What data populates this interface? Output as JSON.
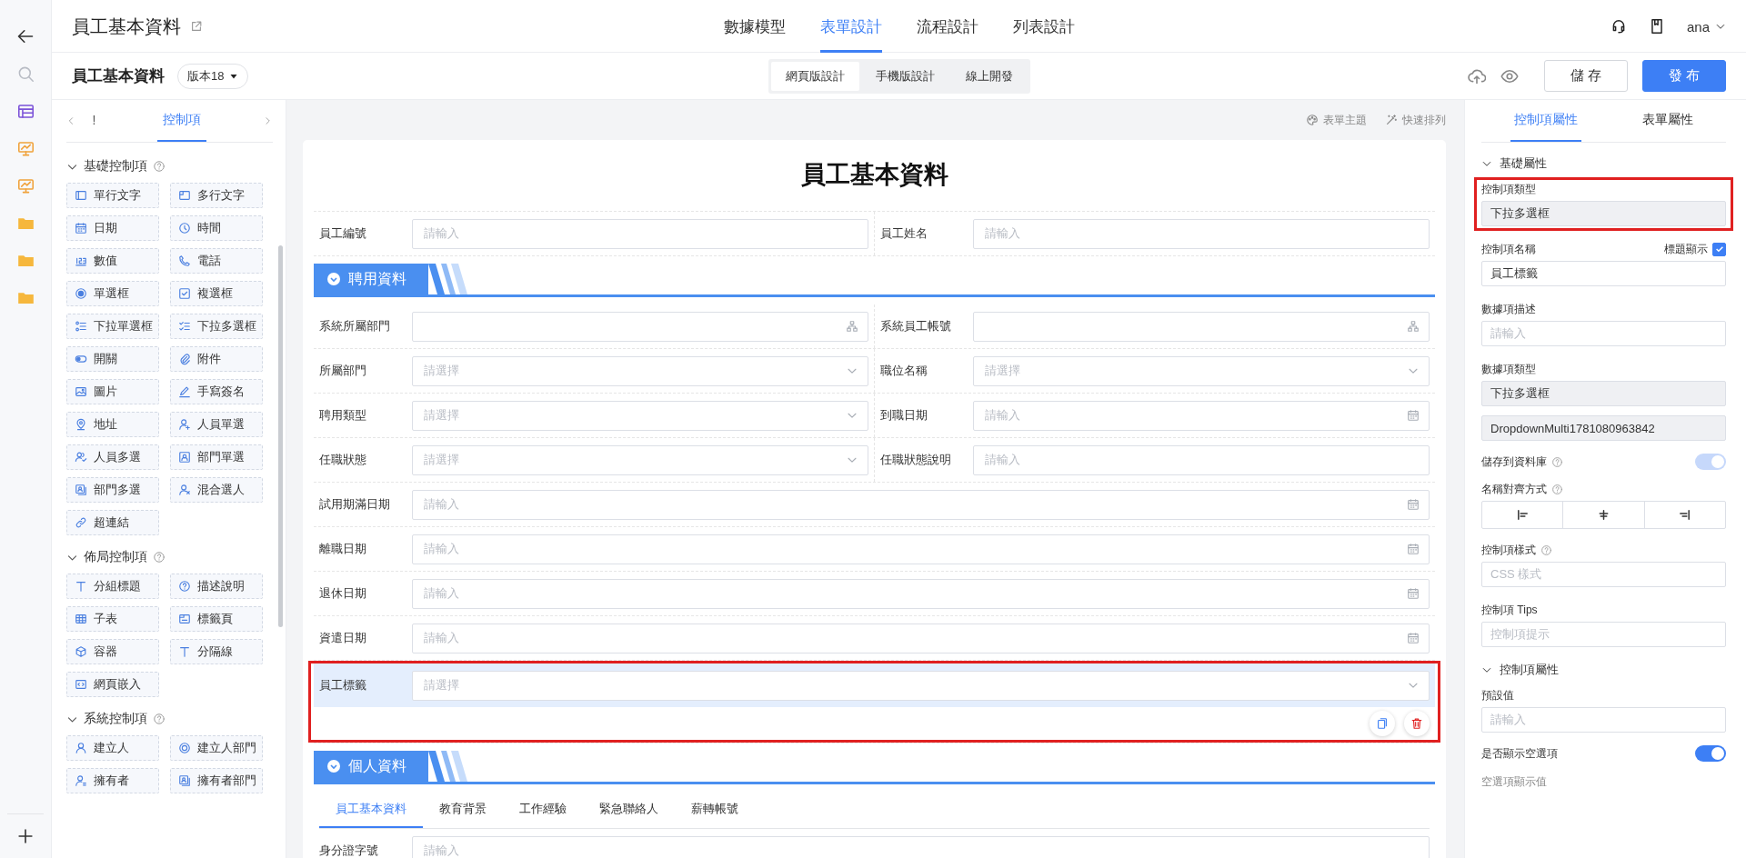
{
  "header": {
    "title": "員工基本資料",
    "nav": [
      {
        "label": "數據模型",
        "selected": false
      },
      {
        "label": "表單設計",
        "selected": true
      },
      {
        "label": "流程設計",
        "selected": false
      },
      {
        "label": "列表設計",
        "selected": false
      }
    ],
    "user": "ana"
  },
  "toolbar": {
    "form_name": "員工基本資料",
    "version": "版本18",
    "modes": [
      {
        "label": "網頁版設計",
        "selected": true
      },
      {
        "label": "手機版設計",
        "selected": false
      },
      {
        "label": "線上開發",
        "selected": false
      }
    ],
    "save": "儲 存",
    "publish": "發 布"
  },
  "palette": {
    "tabs": [
      {
        "label": "!",
        "selected": false
      },
      {
        "label": "控制項",
        "selected": true
      }
    ],
    "groups": [
      {
        "title": "基礎控制項",
        "items": [
          "單行文字",
          "多行文字",
          "日期",
          "時間",
          "數值",
          "電話",
          "單選框",
          "複選框",
          "下拉單選框",
          "下拉多選框",
          "開關",
          "附件",
          "圖片",
          "手寫簽名",
          "地址",
          "人員單選",
          "人員多選",
          "部門單選",
          "部門多選",
          "混合選人",
          "超連結"
        ]
      },
      {
        "title": "佈局控制項",
        "items": [
          "分組標題",
          "描述說明",
          "子表",
          "標籤頁",
          "容器",
          "分隔線",
          "網頁嵌入"
        ]
      },
      {
        "title": "系統控制項",
        "items": [
          "建立人",
          "建立人部門",
          "擁有者",
          "擁有者部門"
        ]
      }
    ]
  },
  "canvas": {
    "tools": [
      "表單主題",
      "快速排列"
    ],
    "form_title": "員工基本資料",
    "rows": [
      {
        "kind": "pair",
        "fields": [
          {
            "label": "員工編號",
            "placeholder": "請輸入",
            "kind": "text",
            "selected": false,
            "highlighted": false
          },
          {
            "label": "員工姓名",
            "placeholder": "請輸入",
            "kind": "text",
            "selected": false,
            "highlighted": false
          }
        ]
      },
      {
        "kind": "section",
        "title": "聘用資料"
      },
      {
        "kind": "pair",
        "fields": [
          {
            "label": "系統所屬部門",
            "kind": "org",
            "selected": false,
            "highlighted": false
          },
          {
            "label": "系統員工帳號",
            "kind": "org",
            "selected": false,
            "highlighted": false
          }
        ]
      },
      {
        "kind": "pair",
        "fields": [
          {
            "label": "所屬部門",
            "placeholder": "請選擇",
            "kind": "select",
            "selected": false,
            "highlighted": false
          },
          {
            "label": "職位名稱",
            "placeholder": "請選擇",
            "kind": "select",
            "selected": false,
            "highlighted": false
          }
        ]
      },
      {
        "kind": "pair",
        "fields": [
          {
            "label": "聘用類型",
            "placeholder": "請選擇",
            "kind": "select",
            "selected": false,
            "highlighted": false
          },
          {
            "label": "到職日期",
            "placeholder": "請輸入",
            "kind": "date",
            "selected": false,
            "highlighted": false
          }
        ]
      },
      {
        "kind": "pair",
        "fields": [
          {
            "label": "任職狀態",
            "placeholder": "請選擇",
            "kind": "select",
            "selected": false,
            "highlighted": false
          },
          {
            "label": "任職狀態說明",
            "placeholder": "請輸入",
            "kind": "text",
            "selected": false,
            "highlighted": false
          }
        ]
      },
      {
        "kind": "single",
        "fields": [
          {
            "label": "試用期滿日期",
            "placeholder": "請輸入",
            "kind": "date",
            "selected": false,
            "highlighted": false
          }
        ]
      },
      {
        "kind": "single",
        "fields": [
          {
            "label": "離職日期",
            "placeholder": "請輸入",
            "kind": "date",
            "selected": false,
            "highlighted": false
          }
        ]
      },
      {
        "kind": "single",
        "fields": [
          {
            "label": "退休日期",
            "placeholder": "請輸入",
            "kind": "date",
            "selected": false,
            "highlighted": false
          }
        ]
      },
      {
        "kind": "single",
        "fields": [
          {
            "label": "資遣日期",
            "placeholder": "請輸入",
            "kind": "date",
            "selected": false,
            "highlighted": false
          }
        ]
      },
      {
        "kind": "single",
        "fields": [
          {
            "label": "員工標籤",
            "placeholder": "請選擇",
            "kind": "select",
            "selected": true,
            "highlighted": true
          }
        ]
      },
      {
        "kind": "section",
        "title": "個人資料"
      },
      {
        "kind": "tabs",
        "tabs": [
          {
            "label": "員工基本資料",
            "selected": true
          },
          {
            "label": "教育背景",
            "selected": false
          },
          {
            "label": "工作經驗",
            "selected": false
          },
          {
            "label": "緊急聯絡人",
            "selected": false
          },
          {
            "label": "薪轉帳號",
            "selected": false
          }
        ]
      },
      {
        "kind": "single",
        "fields": [
          {
            "label": "身分證字號",
            "placeholder": "請輸入",
            "kind": "text",
            "selected": false,
            "highlighted": false
          }
        ]
      }
    ]
  },
  "properties": {
    "tabs": [
      {
        "label": "控制項屬性",
        "selected": true
      },
      {
        "label": "表單屬性",
        "selected": false
      }
    ],
    "items": [
      {
        "kind": "section",
        "label": "基礎屬性",
        "expanded": true
      },
      {
        "kind": "field",
        "label": "控制項類型",
        "value": "下拉多選框",
        "disabled": true,
        "highlighted": true
      },
      {
        "kind": "field",
        "label": "控制項名稱",
        "value": "員工標籤",
        "disabled": false,
        "highlighted": false,
        "aside": {
          "label": "標題顯示",
          "checked": true
        }
      },
      {
        "kind": "field",
        "label": "數據項描述",
        "placeholder": "請輸入",
        "disabled": false,
        "highlighted": false
      },
      {
        "kind": "field",
        "label": "數據項類型",
        "value": "下拉多選框",
        "disabled": true,
        "highlighted": false
      },
      {
        "kind": "field",
        "value": "DropdownMulti1781080963842",
        "disabled": true,
        "highlighted": false
      },
      {
        "kind": "toggle",
        "label": "儲存到資料庫",
        "help": true,
        "on": true,
        "disabled": true
      },
      {
        "kind": "align",
        "label": "名稱對齊方式",
        "help": true,
        "options": [
          {
            "kind": "left"
          },
          {
            "kind": "center"
          },
          {
            "kind": "right"
          }
        ]
      },
      {
        "kind": "field",
        "label": "控制項樣式",
        "placeholder": "CSS 樣式",
        "disabled": false,
        "highlighted": false,
        "help": true
      },
      {
        "kind": "field",
        "label": "控制項 Tips",
        "placeholder": "控制項提示",
        "disabled": false,
        "highlighted": false
      },
      {
        "kind": "section",
        "label": "控制項屬性",
        "expanded": true
      },
      {
        "kind": "field",
        "label": "預設值",
        "placeholder": "請輸入",
        "disabled": false,
        "highlighted": false
      },
      {
        "kind": "toggle",
        "label": "是否顯示空選項",
        "on": true,
        "disabled": false
      },
      {
        "kind": "caption",
        "label": "空選項顯示值"
      }
    ]
  }
}
